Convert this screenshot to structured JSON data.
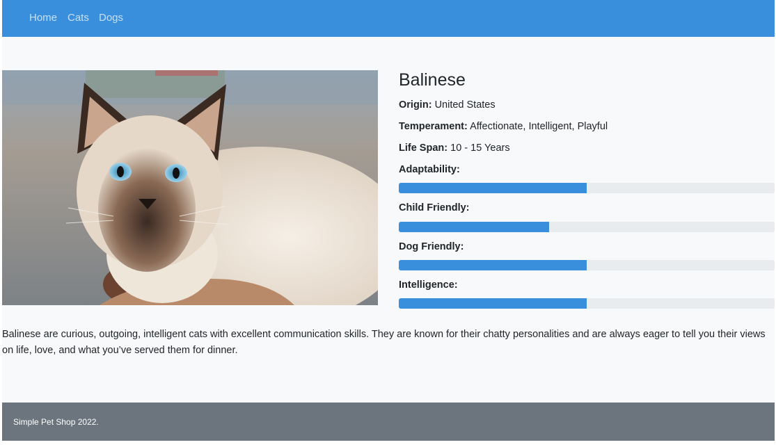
{
  "nav": {
    "items": [
      "Home",
      "Cats",
      "Dogs"
    ]
  },
  "breed": {
    "name": "Balinese",
    "origin_label": "Origin:",
    "origin": "United States",
    "temperament_label": "Temperament:",
    "temperament": "Affectionate, Intelligent, Playful",
    "life_span_label": "Life Span:",
    "life_span": "10 - 15 Years",
    "ratings": [
      {
        "label": "Adaptability:",
        "value": 0.5
      },
      {
        "label": "Child Friendly:",
        "value": 0.4
      },
      {
        "label": "Dog Friendly:",
        "value": 0.5
      },
      {
        "label": "Intelligence:",
        "value": 0.5
      }
    ],
    "description": "Balinese are curious, outgoing, intelligent cats with excellent communication skills. They are known for their chatty personalities and are always eager to tell you their views on life, love, and what you’ve served them for dinner."
  },
  "footer": {
    "text": "Simple Pet Shop 2022."
  },
  "colors": {
    "primary": "#3a8fdc",
    "track": "#e9ecef",
    "footer": "#6c757d",
    "page_bg": "#f8f9fa"
  },
  "image": {
    "icon": "cat-photo"
  }
}
